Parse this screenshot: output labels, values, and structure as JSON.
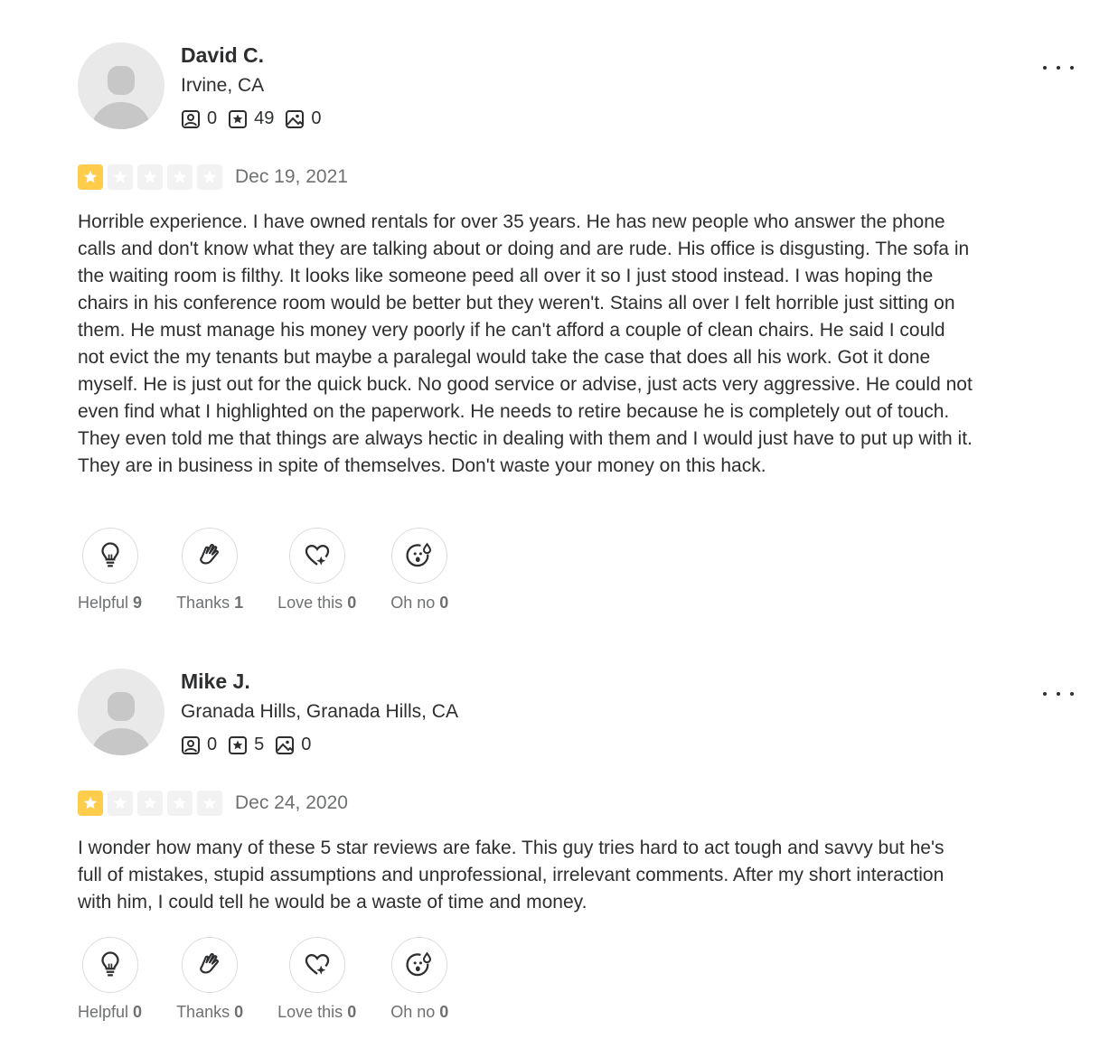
{
  "reviews": [
    {
      "user": {
        "name": "David C.",
        "location": "Irvine, CA",
        "friends": "0",
        "reviews": "49",
        "photos": "0"
      },
      "rating": 1,
      "date": "Dec 19, 2021",
      "text": "Horrible experience. I have owned rentals for over 35 years. He has new people who answer the phone calls and don't know what they are talking about or doing and are rude. His office is disgusting. The sofa in the waiting room is filthy. It looks like someone peed all over it so I just stood instead. I was hoping the chairs in his conference room would be better but they weren't. Stains all over I felt horrible just sitting on them. He must manage his money very poorly if he can't afford a couple of clean chairs. He said I could not evict the my tenants but maybe a paralegal would take the case that does all his work. Got it done myself. He is just out for the quick buck. No good service or advise, just acts very aggressive. He could not even find what I highlighted on the paperwork. He needs to retire because he is completely out of touch. They even told me that things are always hectic in dealing with them and I would just have to put up with it. They are in business in spite of themselves. Don't waste your money on this hack.",
      "reactions": [
        {
          "label": "Helpful",
          "count": "9"
        },
        {
          "label": "Thanks",
          "count": "1"
        },
        {
          "label": "Love this",
          "count": "0"
        },
        {
          "label": "Oh no",
          "count": "0"
        }
      ]
    },
    {
      "user": {
        "name": "Mike J.",
        "location": "Granada Hills, Granada Hills, CA",
        "friends": "0",
        "reviews": "5",
        "photos": "0"
      },
      "rating": 1,
      "date": "Dec 24, 2020",
      "text": "I wonder how many of these 5 star reviews are fake. This guy tries hard to act tough and savvy but he's full of mistakes, stupid assumptions and unprofessional, irrelevant comments. After my short interaction with him, I could tell he would be a waste of time and money.",
      "reactions": [
        {
          "label": "Helpful",
          "count": "0"
        },
        {
          "label": "Thanks",
          "count": "0"
        },
        {
          "label": "Love this",
          "count": "0"
        },
        {
          "label": "Oh no",
          "count": "0"
        }
      ]
    }
  ],
  "colors": {
    "star_on": "#ffcc4b",
    "star_off": "#f2f2f2",
    "text": "#2d2e2f",
    "muted": "#6e7072"
  },
  "icons": [
    "friends-icon",
    "review-star-icon",
    "photo-icon",
    "lightbulb-icon",
    "clapping-hands-icon",
    "heart-sparkle-icon",
    "surprised-face-icon",
    "more-options-icon"
  ]
}
